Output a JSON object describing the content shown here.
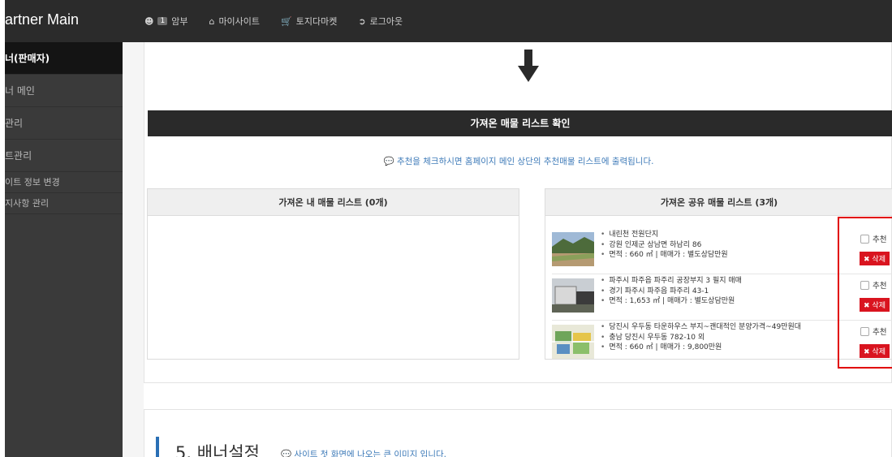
{
  "header": {
    "brand": "artner Main",
    "nav": [
      {
        "icon": "user-icon",
        "badge": "1",
        "label": "암부"
      },
      {
        "icon": "home-icon",
        "label": "마이사이트"
      },
      {
        "icon": "cart-icon",
        "label": "토지다마켓"
      },
      {
        "icon": "logout-icon",
        "label": "로그아웃"
      }
    ]
  },
  "sidebar": {
    "items": [
      {
        "label": "너(판매자)"
      },
      {
        "label": "너 메인"
      },
      {
        "label": "관리"
      },
      {
        "label": "트관리"
      },
      {
        "label": "이트 정보 변경"
      },
      {
        "label": "지사항 관리"
      }
    ]
  },
  "main": {
    "section_title": "가져온 매물 리스트 확인",
    "notice": "추천을 체크하시면 홈페이지 메인 상단의 추천매물 리스트에 출력됩니다.",
    "left_box": {
      "title": "가져온 내 매물 리스트 (0개)"
    },
    "right_box": {
      "title": "가져온 공유 매물 리스트 (3개)",
      "recommend_label": "추천",
      "delete_label": "삭제",
      "listings": [
        {
          "line1": "내린천 전원단지",
          "line2": "강원 인제군 상남면 하남리 86",
          "line3": "면적 : 660 ㎡ | 매매가 : 별도상담만원",
          "thumb": "mountain-field-photo"
        },
        {
          "line1": "파주시 파주읍 파주리 공장부지 3 필지 매매",
          "line2": "경기 파주시 파주읍 파주리 43-1",
          "line3": "면적 : 1,653 ㎡ | 매매가 : 별도상담만원",
          "thumb": "factory-site-photo"
        },
        {
          "line1": "당진시 우두동 타운하우스 부지~괜대적인 분양가격~49만원대",
          "line2": "충남 당진시 우두동 782-10 외",
          "line3": "면적 : 660 ㎡ | 매매가 : 9,800만원",
          "thumb": "site-plan-map"
        }
      ]
    }
  },
  "section5": {
    "title": "5. 배너설정",
    "subtitle": "사이트 첫 화면에 나오는 큰 이미지 입니다."
  },
  "colors": {
    "topbar": "#2b2b2b",
    "sidebar": "#3a3a3a",
    "accent_blue": "#3d7ab8",
    "delete_red": "#d9141f",
    "highlight_red": "#e10000"
  }
}
